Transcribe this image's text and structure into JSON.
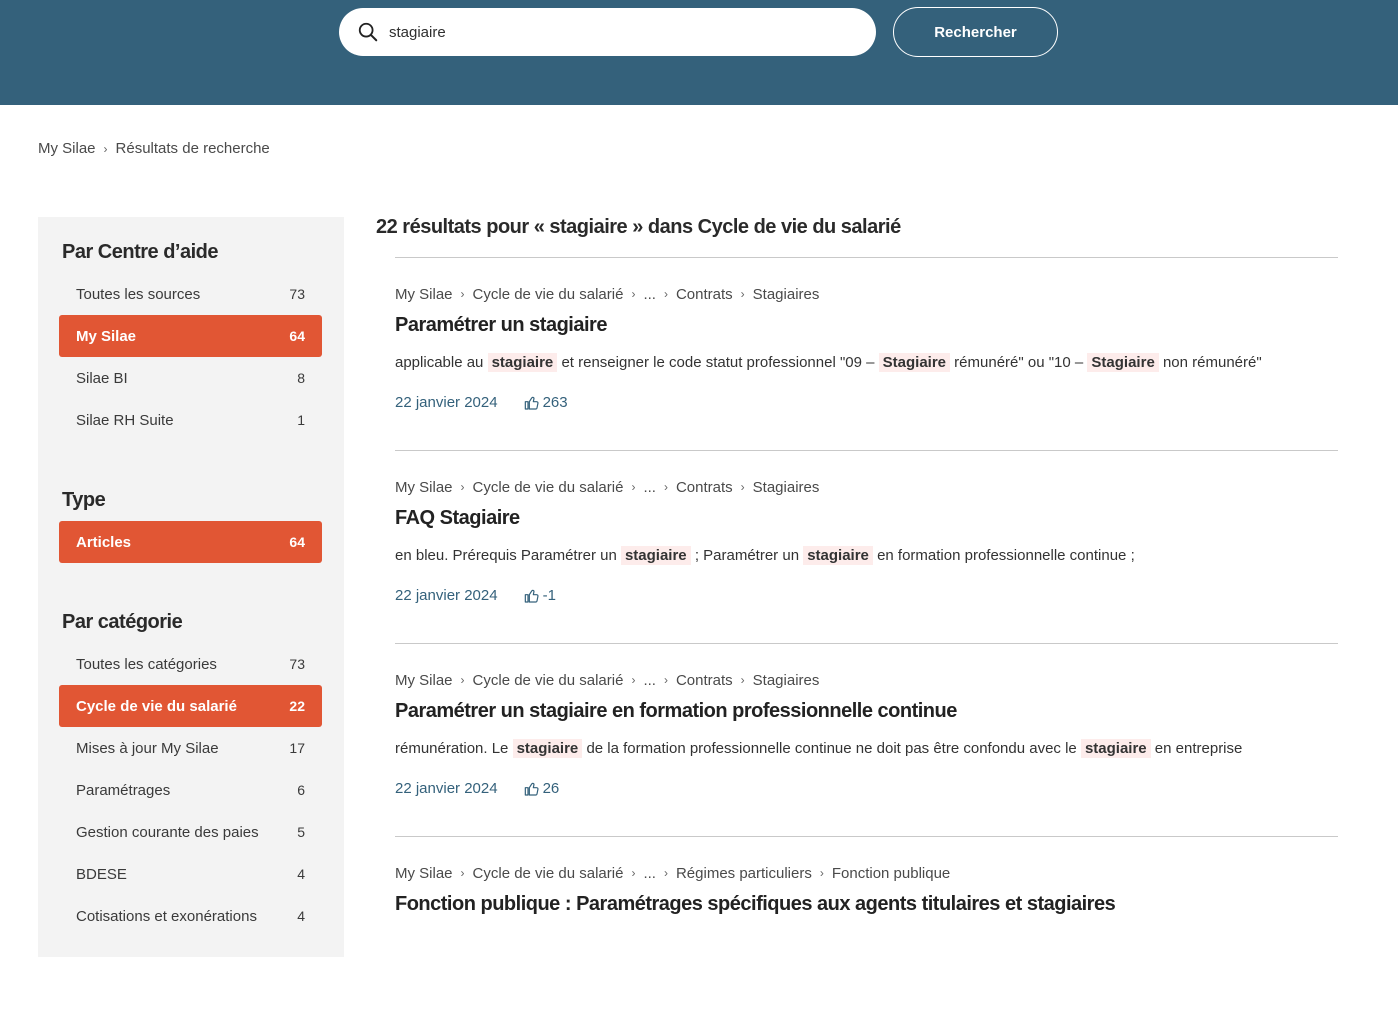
{
  "search": {
    "value": "stagiaire",
    "placeholder": "",
    "button_label": "Rechercher"
  },
  "breadcrumb": {
    "home": "My Silae",
    "current": "Résultats de recherche"
  },
  "sidebar": {
    "sections": [
      {
        "title": "Par Centre d’aide",
        "items": [
          {
            "label": "Toutes les sources",
            "count": "73"
          },
          {
            "label": "My Silae",
            "count": "64"
          },
          {
            "label": "Silae BI",
            "count": "8"
          },
          {
            "label": "Silae RH Suite",
            "count": "1"
          }
        ]
      },
      {
        "title": "Type",
        "items": [
          {
            "label": "Articles",
            "count": "64"
          }
        ]
      },
      {
        "title": "Par catégorie",
        "items": [
          {
            "label": "Toutes les catégories",
            "count": "73"
          },
          {
            "label": "Cycle de vie du salarié",
            "count": "22"
          },
          {
            "label": "Mises à jour My Silae",
            "count": "17"
          },
          {
            "label": "Paramétrages",
            "count": "6"
          },
          {
            "label": "Gestion courante des paies",
            "count": "5"
          },
          {
            "label": "BDESE",
            "count": "4"
          },
          {
            "label": "Cotisations et exonérations",
            "count": "4"
          }
        ]
      }
    ]
  },
  "results_heading": "22 résultats pour « stagiaire » dans Cycle de vie du salarié",
  "results": [
    {
      "crumbs": [
        "My Silae",
        "Cycle de vie du salarié",
        "...",
        "Contrats",
        "Stagiaires"
      ],
      "title": "Paramétrer un stagiaire",
      "snippet": [
        {
          "t": "applicable au ",
          "h": false
        },
        {
          "t": "stagiaire",
          "h": true
        },
        {
          "t": " et renseigner le code statut professionnel \"09 – ",
          "h": false
        },
        {
          "t": "Stagiaire",
          "h": true
        },
        {
          "t": " rémunéré\" ou \"10 – ",
          "h": false
        },
        {
          "t": "Stagiaire",
          "h": true
        },
        {
          "t": " non rémunéré\"",
          "h": false
        }
      ],
      "date": "22 janvier 2024",
      "votes": "263"
    },
    {
      "crumbs": [
        "My Silae",
        "Cycle de vie du salarié",
        "...",
        "Contrats",
        "Stagiaires"
      ],
      "title": "FAQ Stagiaire",
      "snippet": [
        {
          "t": "en bleu. Prérequis Paramétrer un ",
          "h": false
        },
        {
          "t": "stagiaire",
          "h": true
        },
        {
          "t": " ; Paramétrer un ",
          "h": false
        },
        {
          "t": "stagiaire",
          "h": true
        },
        {
          "t": " en formation professionnelle continue ;",
          "h": false
        }
      ],
      "date": "22 janvier 2024",
      "votes": "-1"
    },
    {
      "crumbs": [
        "My Silae",
        "Cycle de vie du salarié",
        "...",
        "Contrats",
        "Stagiaires"
      ],
      "title": "Paramétrer un stagiaire en formation professionnelle continue",
      "snippet": [
        {
          "t": "rémunération. Le ",
          "h": false
        },
        {
          "t": "stagiaire",
          "h": true
        },
        {
          "t": " de la formation professionnelle continue ne doit pas être confondu avec le ",
          "h": false
        },
        {
          "t": "stagiaire",
          "h": true
        },
        {
          "t": " en entreprise",
          "h": false
        }
      ],
      "date": "22 janvier 2024",
      "votes": "26"
    },
    {
      "crumbs": [
        "My Silae",
        "Cycle de vie du salarié",
        "...",
        "Régimes particuliers",
        "Fonction publique"
      ],
      "title": "Fonction publique : Paramétrages spécifiques aux agents titulaires et stagiaires",
      "snippet": [],
      "date": "",
      "votes": ""
    }
  ],
  "colors": {
    "header": "#34617b",
    "accent": "#e15634",
    "link": "#34617b",
    "highlight": "#fdeceb"
  },
  "icons": {
    "search": "search-icon",
    "votes": "thumbs-up-icon"
  }
}
